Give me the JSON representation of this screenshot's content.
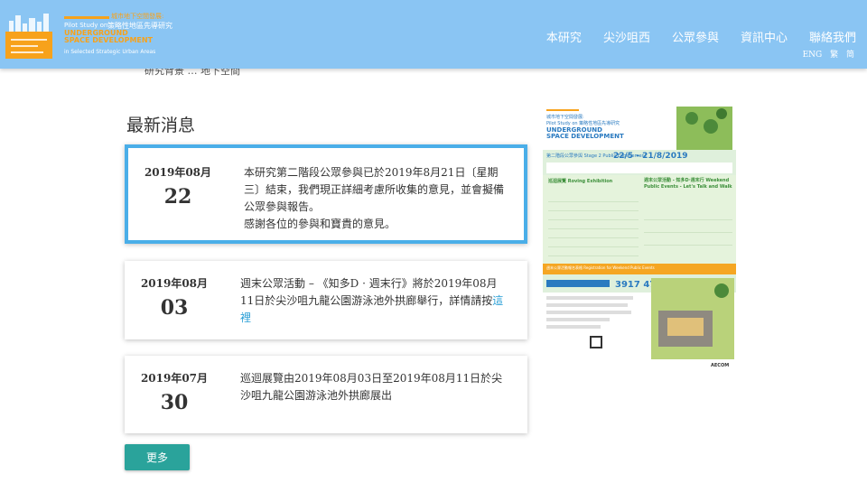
{
  "header": {
    "logo": {
      "zh_line1": "城市地下空間發展:",
      "en_line1": "Pilot Study on",
      "zh_line2": "策略性地區先導研究",
      "en_line2": "UNDERGROUND",
      "en_line3": "SPACE DEVELOPMENT",
      "en_line4": "in Selected Strategic Urban Areas"
    },
    "nav": [
      "本研究",
      "尖沙咀西",
      "公眾參與",
      "資訊中心",
      "聯絡我們"
    ],
    "lang": [
      "ENG",
      "繁",
      "简"
    ]
  },
  "behind_text": "研究背景 … 地下空間",
  "news": {
    "title": "最新消息",
    "items": [
      {
        "year_month": "2019年08月",
        "day": "22",
        "text": "本研究第二階段公眾參與已於2019年8月21日〔星期三〕結束，我們現正詳細考慮所收集的意見，並會擬備公眾參與報告。",
        "text2": "感謝各位的參與和寶貴的意見。"
      },
      {
        "year_month": "2019年08月",
        "day": "03",
        "text": "週末公眾活動 – 《知多D · 週末行》將於2019年08月11日於尖沙咀九龍公園游泳池外拱廊舉行，詳情請按",
        "link": "這裡"
      },
      {
        "year_month": "2019年07月",
        "day": "30",
        "text": "巡迴展覽由2019年08月03日至2019年08月11日於尖沙咀九龍公園游泳池外拱廊展出"
      }
    ],
    "more_label": "更多"
  },
  "poster": {
    "head_zh": "城市地下空間發展:",
    "head_en1": "Pilot Study on 策略性地區先導研究",
    "head_en2": "UNDERGROUND",
    "head_en3": "SPACE DEVELOPMENT",
    "stage": "第二階段公眾參與 Stage 2 Public Engagement",
    "dates": "22/5 - 21/8/2019",
    "roving": "巡迴展覽 Roving Exhibition",
    "weekend": "週末公眾活動 - 知多D·週末行 Weekend Public Events - Let's Talk and Walk",
    "register": "週末公眾活動報名表格 Registration for Weekend Public Events",
    "phone": "3917 4761",
    "aecom": "AECOM"
  },
  "colors": {
    "header_bg": "#8ac5f3",
    "accent_orange": "#f7a21b",
    "active_border": "#4aaee8",
    "more_button": "#2aa39b",
    "link": "#2a9fd6"
  }
}
